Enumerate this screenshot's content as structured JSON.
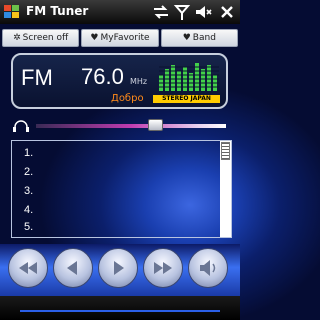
{
  "title_bar": {
    "title": "FM Tuner",
    "icons": [
      "windows-start-icon",
      "connectivity-icon",
      "signal-icon",
      "volume-mute-icon",
      "close-icon"
    ]
  },
  "toolbar": {
    "buttons": [
      {
        "icon": "gear-icon",
        "label": "Screen off"
      },
      {
        "icon": "heart-icon",
        "label": "MyFavorite"
      },
      {
        "icon": "heart-icon",
        "label": "Band"
      }
    ]
  },
  "display": {
    "band": "FM",
    "frequency": "76.0",
    "unit": "MHz",
    "station_name": "Добро",
    "stereo_badge": "STEREO JAPAN",
    "colors": {
      "station": "#ff8a1a",
      "badge": "#ffcc00",
      "eq": "#43d14a"
    }
  },
  "volume": {
    "icon": "headphones-icon",
    "level": 0.63
  },
  "presets": {
    "items": [
      "1.",
      "2.",
      "3.",
      "4.",
      "5."
    ]
  },
  "controls": [
    {
      "name": "seek-back-button",
      "icon": "rewind-icon"
    },
    {
      "name": "prev-button",
      "icon": "prev-icon"
    },
    {
      "name": "next-button",
      "icon": "play-icon"
    },
    {
      "name": "seek-forward-button",
      "icon": "fast-forward-icon"
    },
    {
      "name": "speaker-button",
      "icon": "speaker-icon"
    }
  ]
}
